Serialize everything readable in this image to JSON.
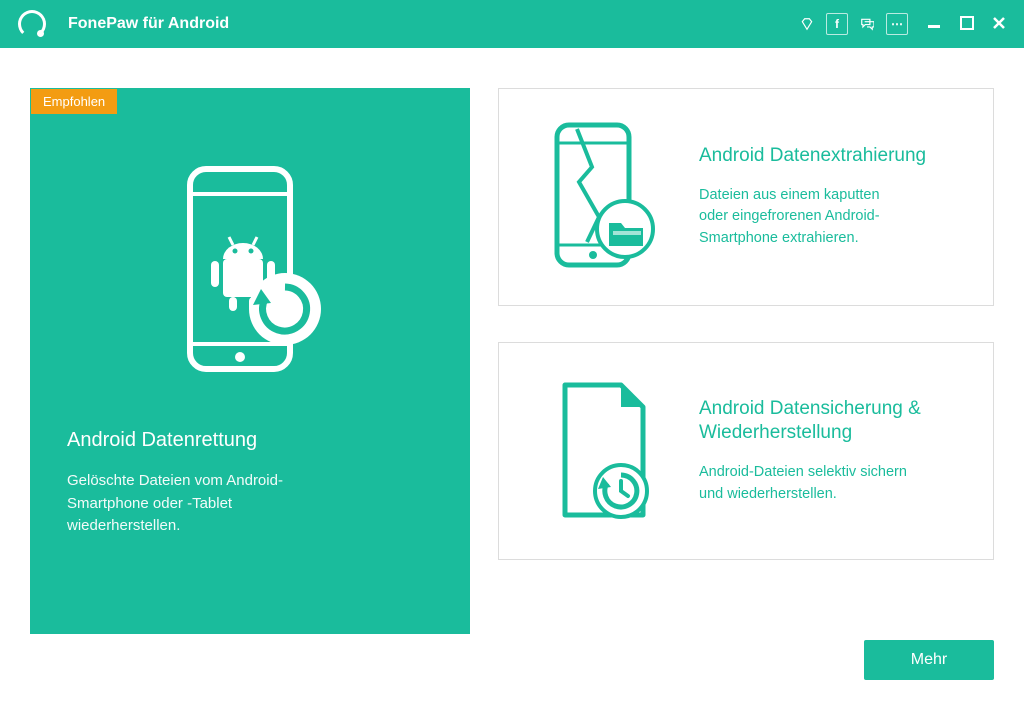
{
  "app": {
    "title": "FonePaw für Android"
  },
  "titlebar_icons": {
    "diamond": "diamond-icon",
    "facebook": "f",
    "chat": "chat-icon",
    "more": "⋯"
  },
  "recommended_badge": "Empfohlen",
  "cards": {
    "recovery": {
      "title": "Android Datenrettung",
      "desc": "Gelöschte Dateien vom Android-\nSmartphone oder -Tablet\nwiederherstellen."
    },
    "extraction": {
      "title": "Android Datenextrahierung",
      "desc": "Dateien aus einem kaputten\noder eingefrorenen Android-\nSmartphone extrahieren."
    },
    "backup": {
      "title": "Android Datensicherung &\nWiederherstellung",
      "desc": "Android-Dateien selektiv sichern\nund wiederherstellen."
    }
  },
  "more_button": "Mehr",
  "colors": {
    "teal": "#1abc9c",
    "orange": "#f39c12"
  }
}
